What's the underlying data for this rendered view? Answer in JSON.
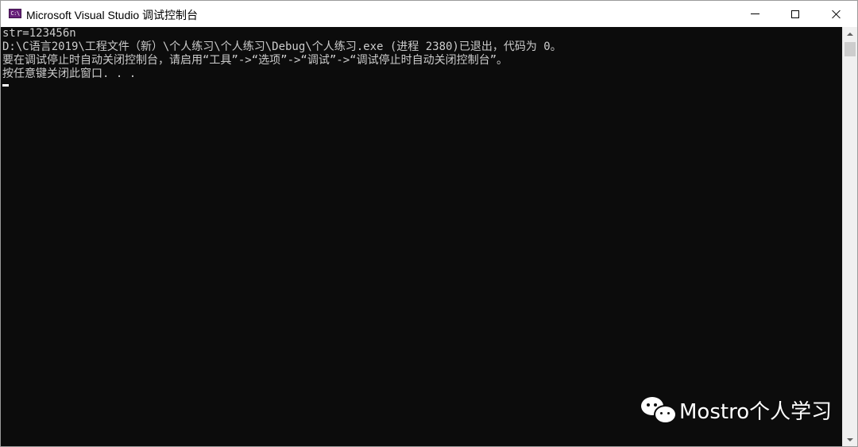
{
  "window": {
    "icon_text": "C:\\",
    "title": "Microsoft Visual Studio 调试控制台"
  },
  "console": {
    "lines": [
      "str=123456n",
      "D:\\C语言2019\\工程文件（新）\\个人练习\\个人练习\\Debug\\个人练习.exe (进程 2380)已退出，代码为 0。",
      "要在调试停止时自动关闭控制台，请启用“工具”->“选项”->“调试”->“调试停止时自动关闭控制台”。",
      "按任意键关闭此窗口. . ."
    ]
  },
  "watermark": {
    "icon": "wechat-icon",
    "text": "Mostro个人学习"
  },
  "colors": {
    "console_bg": "#0c0c0c",
    "console_fg": "#cccccc",
    "titlebar_bg": "#ffffff",
    "app_icon_bg": "#68217a"
  }
}
